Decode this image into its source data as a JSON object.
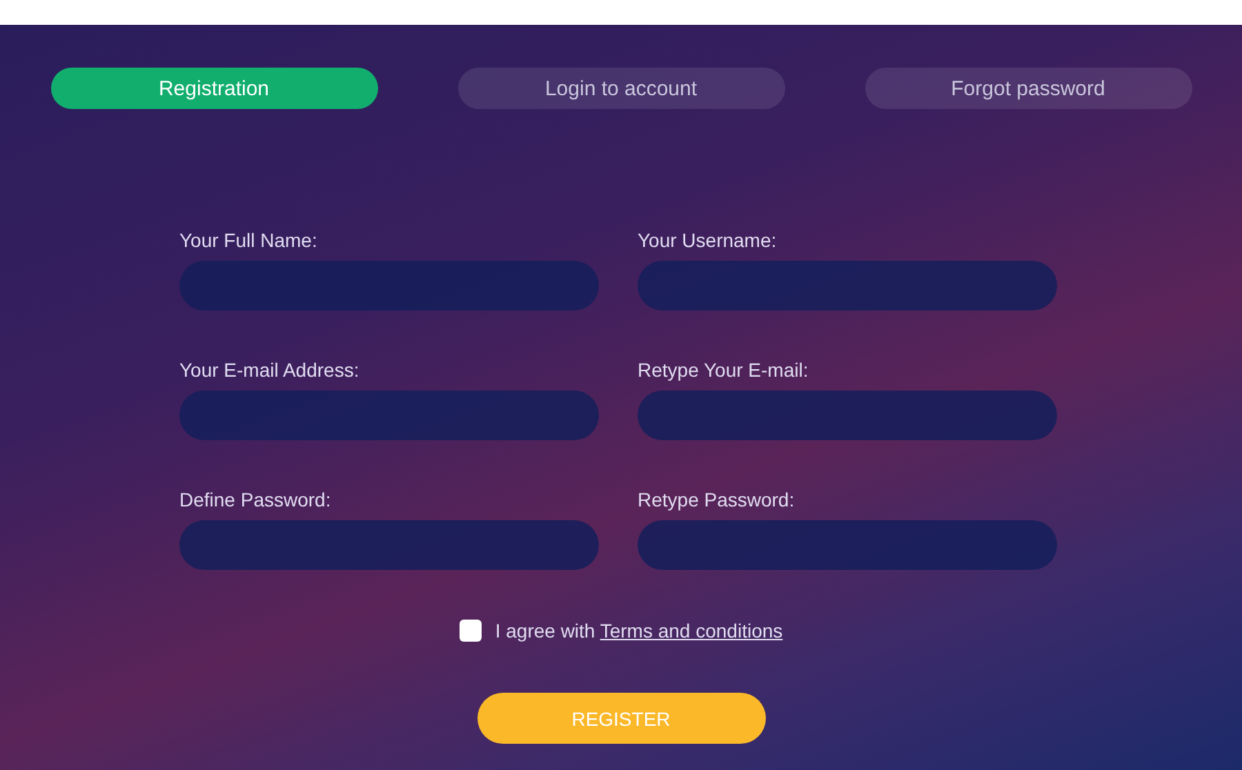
{
  "tabs": [
    {
      "label": "Registration",
      "selected": true
    },
    {
      "label": "Login to account",
      "selected": false
    },
    {
      "label": "Forgot password",
      "selected": false
    }
  ],
  "fields": [
    {
      "label": "Your Full Name:"
    },
    {
      "label": "Your Username:"
    },
    {
      "label": "Your E-mail Address:"
    },
    {
      "label": "Retype Your E-mail:"
    },
    {
      "label": "Define Password:"
    },
    {
      "label": "Retype Password:"
    }
  ],
  "agreement": {
    "checked": false,
    "text": "I agree with",
    "link": "Terms and conditions"
  },
  "button": "REGISTER"
}
